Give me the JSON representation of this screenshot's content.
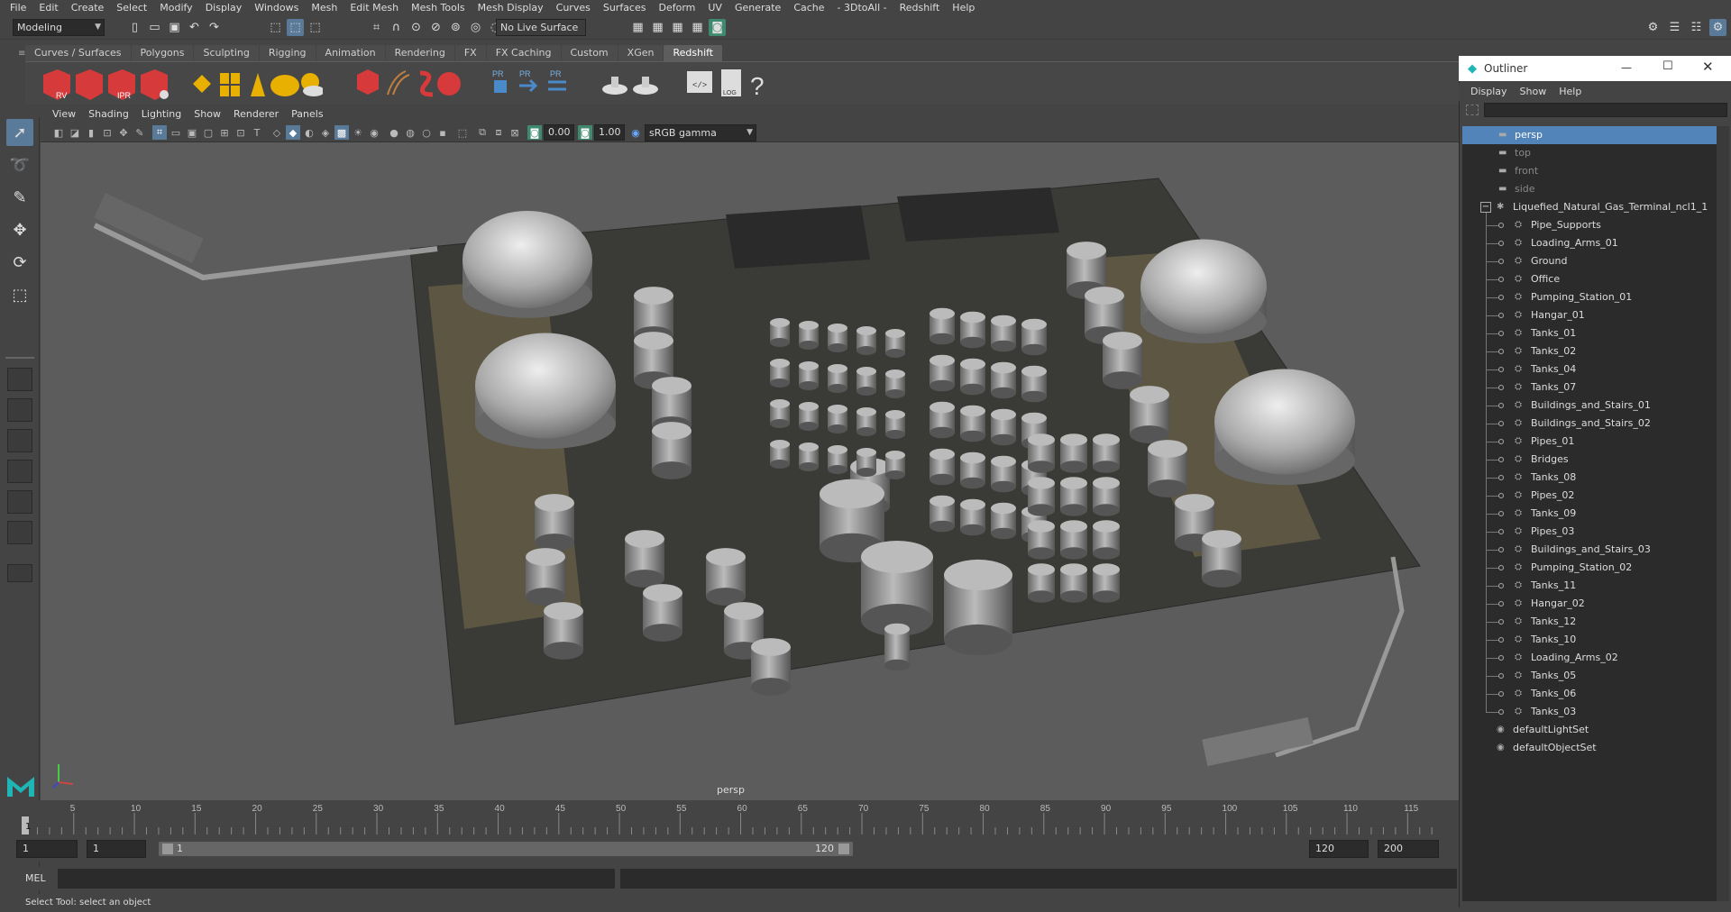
{
  "menubar": {
    "items": [
      "File",
      "Edit",
      "Create",
      "Select",
      "Modify",
      "Display",
      "Windows",
      "Mesh",
      "Edit Mesh",
      "Mesh Tools",
      "Mesh Display",
      "Curves",
      "Surfaces",
      "Deform",
      "UV",
      "Generate",
      "Cache",
      "- 3DtoAll -",
      "Redshift",
      "Help"
    ]
  },
  "statusline": {
    "mode": "Modeling",
    "live_surface": "No Live Surface"
  },
  "shelf": {
    "tabs": [
      "Curves / Surfaces",
      "Polygons",
      "Sculpting",
      "Rigging",
      "Animation",
      "Rendering",
      "FX",
      "FX Caching",
      "Custom",
      "XGen",
      "Redshift"
    ],
    "active_tab": "Redshift",
    "rv": "RV",
    "ipr": "IPR",
    "pr": "PR",
    "log": "LOG",
    "help": "?"
  },
  "viewport": {
    "menu": [
      "View",
      "Shading",
      "Lighting",
      "Show",
      "Renderer",
      "Panels"
    ],
    "exposure": "0.00",
    "gamma": "1.00",
    "colorspace": "sRGB gamma",
    "camera_label": "persp"
  },
  "outliner": {
    "title": "Outliner",
    "menu": [
      "Display",
      "Show",
      "Help"
    ],
    "cameras": [
      "persp",
      "top",
      "front",
      "side"
    ],
    "root": "Liquefied_Natural_Gas_Terminal_ncl1_1",
    "children": [
      "Pipe_Supports",
      "Loading_Arms_01",
      "Ground",
      "Office",
      "Pumping_Station_01",
      "Hangar_01",
      "Tanks_01",
      "Tanks_02",
      "Tanks_04",
      "Tanks_07",
      "Buildings_and_Stairs_01",
      "Buildings_and_Stairs_02",
      "Pipes_01",
      "Bridges",
      "Tanks_08",
      "Pipes_02",
      "Tanks_09",
      "Pipes_03",
      "Buildings_and_Stairs_03",
      "Pumping_Station_02",
      "Tanks_11",
      "Hangar_02",
      "Tanks_12",
      "Tanks_10",
      "Loading_Arms_02",
      "Tanks_05",
      "Tanks_06",
      "Tanks_03"
    ],
    "sets": [
      "defaultLightSet",
      "defaultObjectSet"
    ]
  },
  "timeline": {
    "ticks": [
      "5",
      "10",
      "15",
      "20",
      "25",
      "30",
      "35",
      "40",
      "45",
      "50",
      "55",
      "60",
      "65",
      "70",
      "75",
      "80",
      "85",
      "90",
      "95",
      "100",
      "105",
      "110",
      "115"
    ],
    "current": "1"
  },
  "range": {
    "start": "1",
    "play_start": "1",
    "slider_start": "1",
    "slider_end": "120",
    "play_end": "120",
    "end": "200"
  },
  "cmd": {
    "label": "MEL"
  },
  "help": {
    "text": "Select Tool: select an object"
  },
  "colors": {
    "accent": "#5a7a99",
    "selection": "#5284ba",
    "redshift": "#d63a3a"
  }
}
